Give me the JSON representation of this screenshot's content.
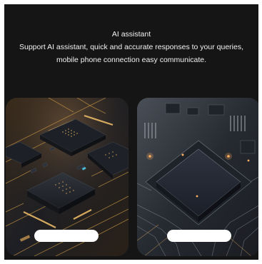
{
  "header": {
    "title": "AI assistant",
    "description": "Support AI assistant, quick and accurate responses to your queries, mobile phone connection easy communicate."
  },
  "cards": [
    {
      "image": "chip-board-gold-image",
      "pill_label": ""
    },
    {
      "image": "processor-chip-image",
      "pill_label": ""
    }
  ],
  "colors": {
    "panel_background": "#151515",
    "gold_trace": "#c89646",
    "chip_body": "#24272d"
  }
}
